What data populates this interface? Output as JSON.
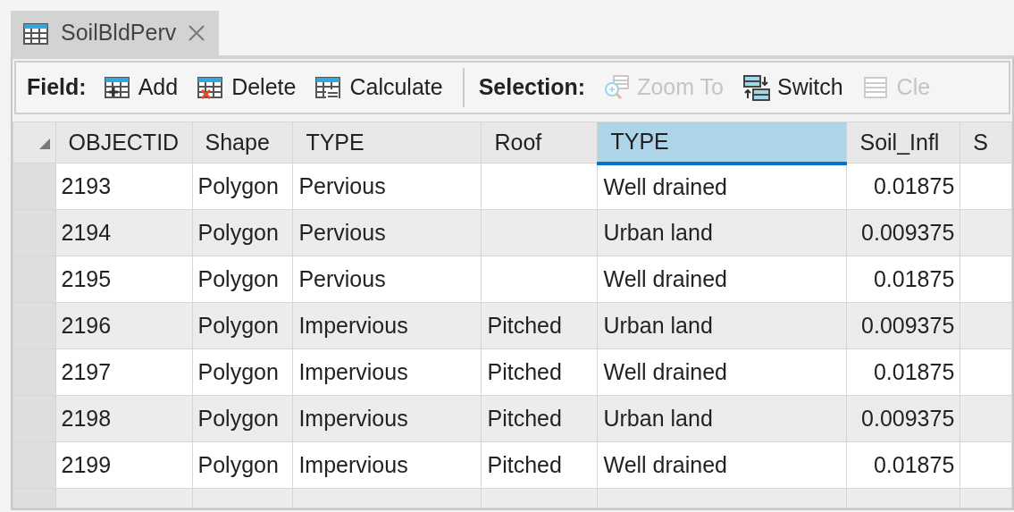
{
  "tab": {
    "title": "SoilBldPerv",
    "selected": true
  },
  "toolbar": {
    "groups": [
      {
        "label": "Field:",
        "buttons": [
          {
            "label": "Add",
            "kind": "add",
            "disabled": false
          },
          {
            "label": "Delete",
            "kind": "delete",
            "disabled": false
          },
          {
            "label": "Calculate",
            "kind": "calculate",
            "disabled": false
          }
        ]
      },
      {
        "label": "Selection:",
        "buttons": [
          {
            "label": "Zoom To",
            "kind": "zoom",
            "disabled": true
          },
          {
            "label": "Switch",
            "kind": "switch",
            "disabled": false
          },
          {
            "label": "Cle",
            "kind": "clear",
            "disabled": true
          }
        ]
      }
    ]
  },
  "table": {
    "columns": [
      {
        "label": "OBJECTID",
        "kind": "text",
        "selected": false
      },
      {
        "label": "Shape",
        "kind": "text",
        "selected": false
      },
      {
        "label": "TYPE",
        "kind": "text",
        "selected": false
      },
      {
        "label": "Roof",
        "kind": "text",
        "selected": false
      },
      {
        "label": "TYPE",
        "kind": "text",
        "selected": true
      },
      {
        "label": "Soil_Infl",
        "kind": "number",
        "selected": false
      },
      {
        "label": "S",
        "kind": "text",
        "selected": false
      }
    ],
    "rows": [
      [
        "2193",
        "Polygon",
        "Pervious",
        "",
        "Well drained",
        "0.01875",
        ""
      ],
      [
        "2194",
        "Polygon",
        "Pervious",
        "",
        "Urban land",
        "0.009375",
        ""
      ],
      [
        "2195",
        "Polygon",
        "Pervious",
        "",
        "Well drained",
        "0.01875",
        ""
      ],
      [
        "2196",
        "Polygon",
        "Impervious",
        "Pitched",
        "Urban land",
        "0.009375",
        ""
      ],
      [
        "2197",
        "Polygon",
        "Impervious",
        "Pitched",
        "Well drained",
        "0.01875",
        ""
      ],
      [
        "2198",
        "Polygon",
        "Impervious",
        "Pitched",
        "Urban land",
        "0.009375",
        ""
      ],
      [
        "2199",
        "Polygon",
        "Impervious",
        "Pitched",
        "Well drained",
        "0.01875",
        ""
      ]
    ]
  }
}
